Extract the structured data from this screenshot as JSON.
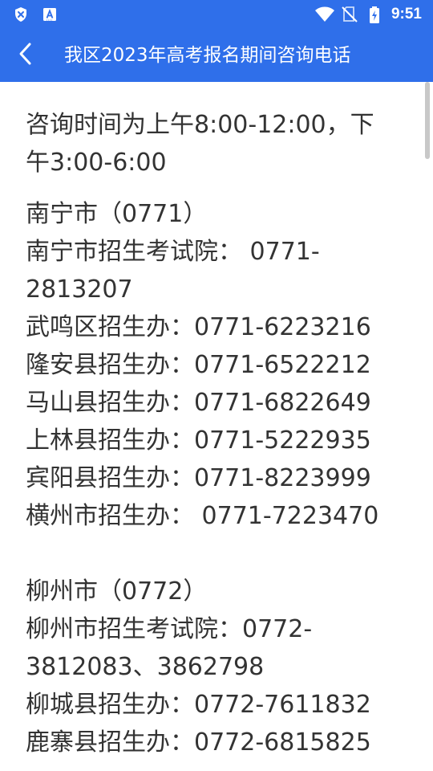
{
  "status_bar": {
    "time": "9:51",
    "icons": [
      "shield-x-icon",
      "font-a-icon",
      "wifi-icon",
      "no-sim-icon",
      "battery-charging-icon"
    ]
  },
  "header": {
    "back_icon": "chevron-left-icon",
    "title": "我区2023年高考报名期间咨询电话"
  },
  "colors": {
    "accent": "#2f6fea",
    "text": "#333333",
    "background": "#ffffff"
  },
  "content": {
    "intro_line1": "咨询时间为上午8:00-12:00，下",
    "intro_line2": "午3:00-6:00",
    "sections": [
      {
        "heading": "南宁市（0771）",
        "lines": [
          "南宁市招生考试院： 0771-",
          "2813207",
          "武鸣区招生办：0771-6223216",
          "隆安县招生办：0771-6522212",
          "马山县招生办：0771-6822649",
          "上林县招生办：0771-5222935",
          "宾阳县招生办：0771-8223999",
          "横州市招生办： 0771-7223470"
        ]
      },
      {
        "heading": "柳州市（0772）",
        "lines": [
          "柳州市招生考试院：0772-",
          "3812083、3862798",
          "柳城县招生办：0772-7611832",
          "鹿寨县招生办：0772-6815825"
        ]
      }
    ]
  }
}
